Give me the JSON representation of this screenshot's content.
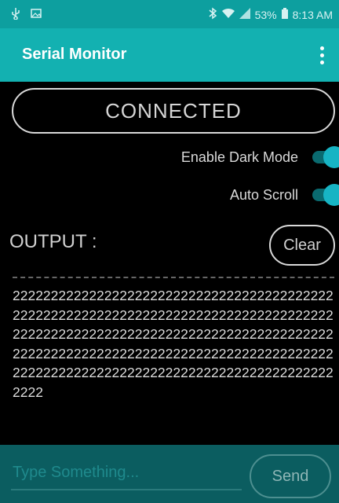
{
  "status_bar": {
    "time": "8:13 AM",
    "battery": "53%",
    "icons": [
      "usb-icon",
      "gallery-icon",
      "bluetooth-icon",
      "wifi-icon",
      "signal-icon",
      "battery-icon"
    ]
  },
  "app_bar": {
    "title": "Serial Monitor",
    "menu_icon": "overflow-menu-icon"
  },
  "connection": {
    "status": "CONNECTED"
  },
  "settings": {
    "dark_mode": {
      "label": "Enable Dark Mode",
      "enabled": true
    },
    "auto_scroll": {
      "label": "Auto Scroll",
      "enabled": true
    }
  },
  "output": {
    "label": "OUTPUT :",
    "clear_label": "Clear",
    "text": "2222222222222222222222222222222222222222222222222222222222222222222222222222222222222222222222222222222222222222222222222222222222222222222222222222222222222222222222222222222222222222222222222222222222222222222222"
  },
  "input": {
    "placeholder": "Type Something...",
    "value": "",
    "send_label": "Send"
  },
  "colors": {
    "status_bar": "#0d9f9f",
    "app_bar": "#13b1b1",
    "input_bar": "#0b5d60",
    "switch_on": "#17b4c4"
  }
}
